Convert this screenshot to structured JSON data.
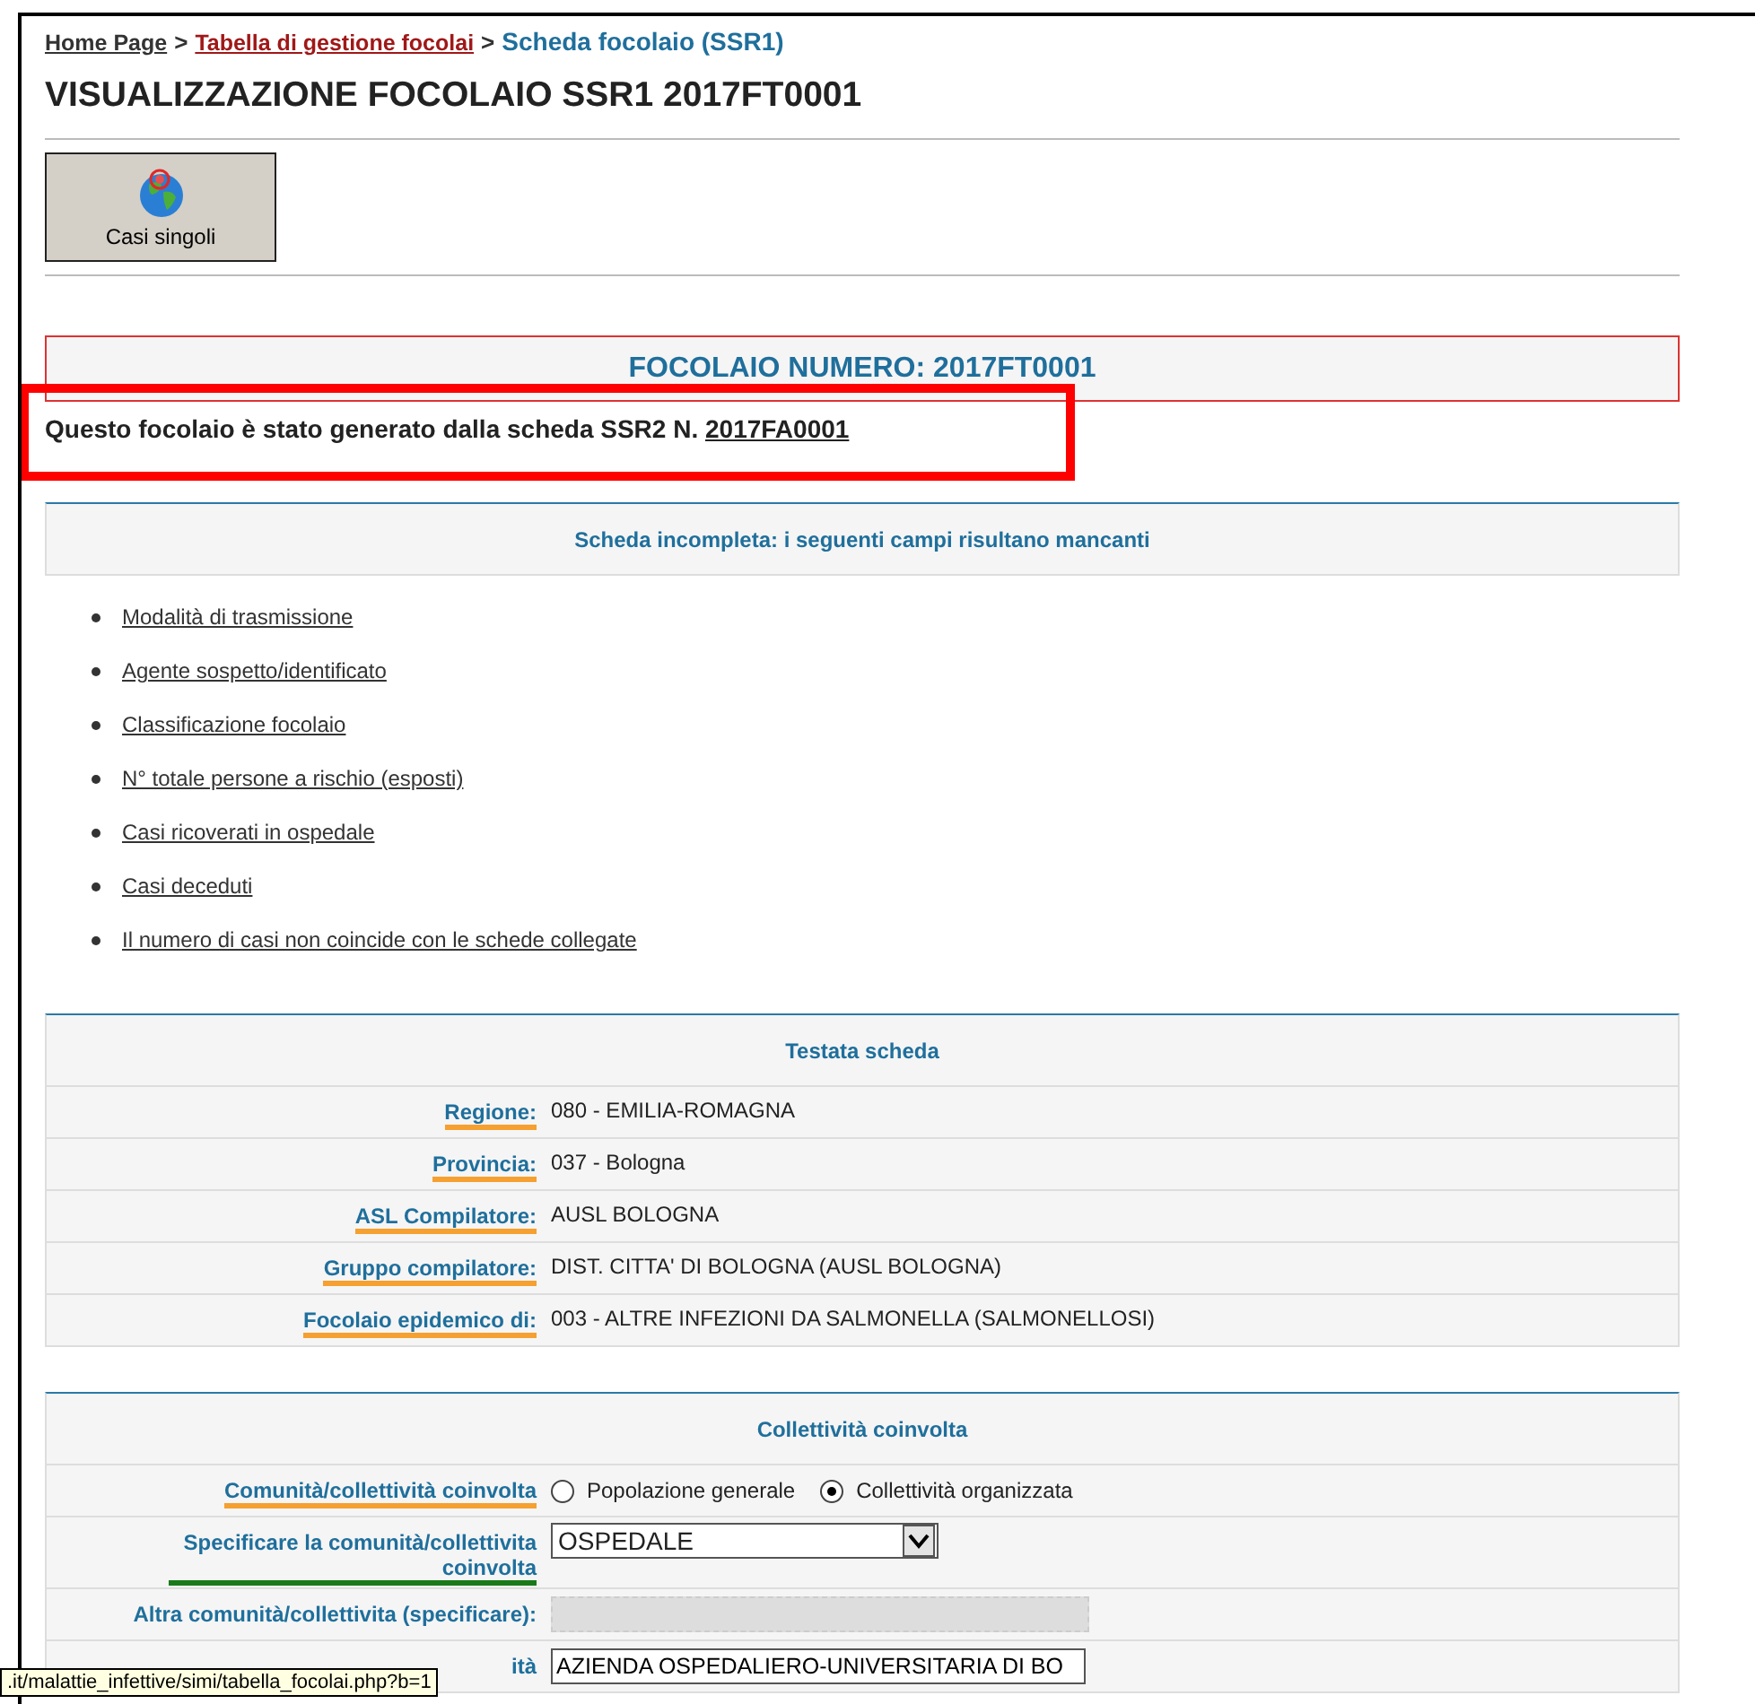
{
  "breadcrumb": [
    {
      "label": "Home Page",
      "kind": "home"
    },
    {
      "label": "Tabella di gestione focolai",
      "kind": "visited"
    },
    {
      "label": "Scheda focolaio (SSR1)",
      "kind": "current"
    }
  ],
  "breadcrumb_separator": ">",
  "title": "VISUALIZZAZIONE FOCOLAIO SSR1 2017FT0001",
  "toolbar": [
    {
      "label": "Casi singoli"
    }
  ],
  "focolaio_header": "FOCOLAIO NUMERO: 2017FT0001",
  "origin_note": {
    "text": "Questo focolaio è stato generato dalla scheda SSR2 N.",
    "link": "2017FA0001",
    "highlighted": true
  },
  "missing_panel": {
    "title": "Scheda incompleta: i seguenti campi risultano mancanti",
    "items": [
      "Modalità di trasmissione",
      "Agente sospetto/identificato",
      "Classificazione focolaio",
      "N° totale persone a rischio (esposti)",
      "Casi ricoverati in ospedale",
      "Casi deceduti",
      "Il numero di casi non coincide con le schede collegate"
    ]
  },
  "testata": {
    "title": "Testata scheda",
    "rows": [
      {
        "label": "Regione:",
        "value": "080 - EMILIA-ROMAGNA",
        "color": "#f5a030"
      },
      {
        "label": "Provincia:",
        "value": "037 - Bologna",
        "color": "#f5a030"
      },
      {
        "label": "ASL Compilatore:",
        "value": "AUSL BOLOGNA",
        "color": "#f5a030"
      },
      {
        "label": "Gruppo compilatore:",
        "value": "DIST. CITTA' DI BOLOGNA (AUSL BOLOGNA)",
        "color": "#f5a030"
      },
      {
        "label": "Focolaio epidemico di:",
        "value": "003 - ALTRE INFEZIONI DA SALMONELLA (SALMONELLOSI)",
        "color": "#f5a030"
      }
    ]
  },
  "collettivita": {
    "title": "Collettività coinvolta",
    "rows": [
      {
        "kind": "radio",
        "label": "Comunità/collettività coinvolta",
        "color": "#f5a030",
        "options": [
          {
            "label": "Popolazione generale",
            "selected": false
          },
          {
            "label": "Collettività organizzata",
            "selected": true
          }
        ]
      },
      {
        "kind": "select",
        "label": "Specificare la comunità/collettivita coinvolta",
        "color": "#1a7a1a",
        "value": "OSPEDALE"
      },
      {
        "kind": "disabled-input",
        "label": "Altra comunità/collettivita (specificare):"
      },
      {
        "kind": "input",
        "label": "ità",
        "value": "AZIENDA OSPEDALIERO-UNIVERSITARIA DI BO"
      }
    ]
  },
  "status_bar": ".it/malattie_infettive/simi/tabella_focolai.php?b=1"
}
